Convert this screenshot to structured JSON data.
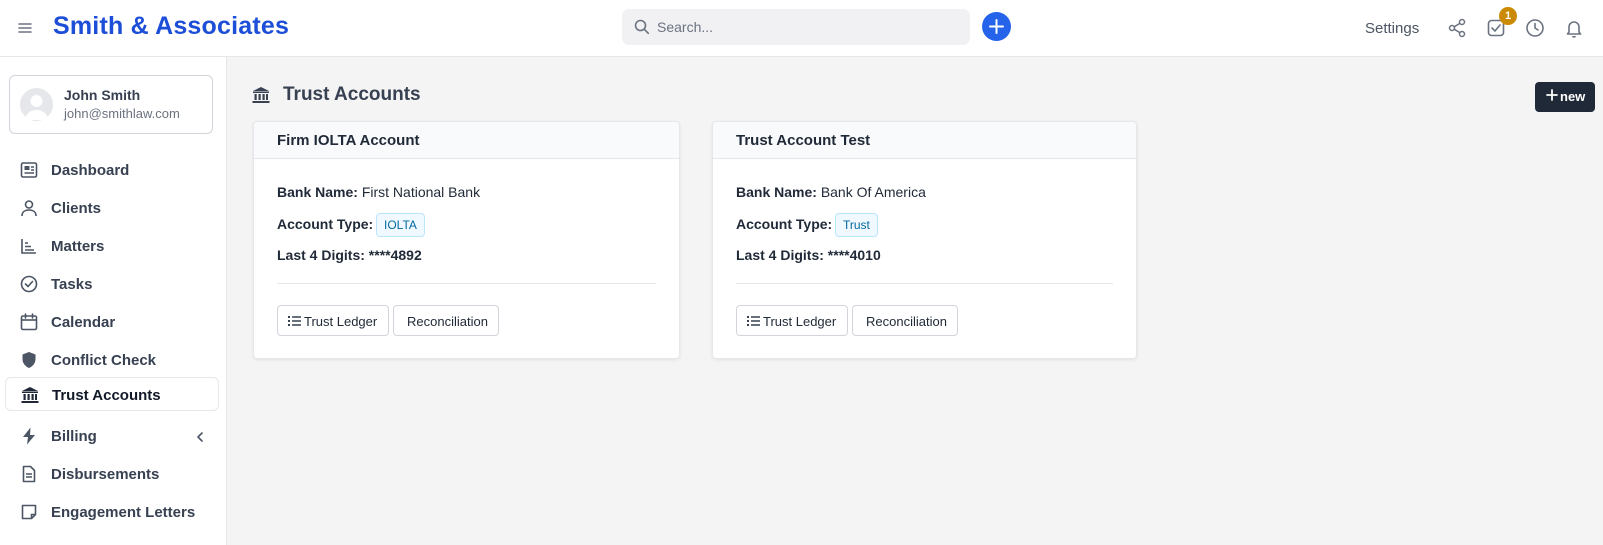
{
  "header": {
    "brand": "Smith & Associates",
    "search_placeholder": "Search...",
    "settings_label": "Settings",
    "tasks_badge": "1"
  },
  "user": {
    "name": "John Smith",
    "email": "john@smithlaw.com"
  },
  "sidebar": {
    "items": [
      {
        "label": "Dashboard",
        "icon": "dashboard-icon"
      },
      {
        "label": "Clients",
        "icon": "user-icon"
      },
      {
        "label": "Matters",
        "icon": "chart-icon"
      },
      {
        "label": "Tasks",
        "icon": "check-circle-icon"
      },
      {
        "label": "Calendar",
        "icon": "calendar-icon"
      },
      {
        "label": "Conflict Check",
        "icon": "shield-icon"
      },
      {
        "label": "Trust Accounts",
        "icon": "bank-icon",
        "active": true
      },
      {
        "label": "Billing",
        "icon": "bolt-icon"
      },
      {
        "label": "Disbursements",
        "icon": "document-icon"
      },
      {
        "label": "Engagement Letters",
        "icon": "note-icon"
      }
    ]
  },
  "main": {
    "title": "Trust Accounts",
    "new_button": "new",
    "accounts": [
      {
        "name": "Firm IOLTA Account",
        "bank_label": "Bank Name:",
        "bank": "First National Bank",
        "type_label": "Account Type:",
        "type": "IOLTA",
        "digits_label": "Last 4 Digits:",
        "digits": "****4892",
        "ledger_button": "Trust Ledger",
        "reconciliation_button": "Reconciliation"
      },
      {
        "name": "Trust Account Test",
        "bank_label": "Bank Name:",
        "bank": "Bank Of America",
        "type_label": "Account Type:",
        "type": "Trust",
        "digits_label": "Last 4 Digits:",
        "digits": "****4010",
        "ledger_button": "Trust Ledger",
        "reconciliation_button": "Reconciliation"
      }
    ]
  },
  "colors": {
    "brand": "#1d4ed8",
    "primary_button": "#2563eb",
    "dark_button": "#1f2937",
    "badge": "#ca8a04",
    "tag_text": "#0369a1"
  }
}
